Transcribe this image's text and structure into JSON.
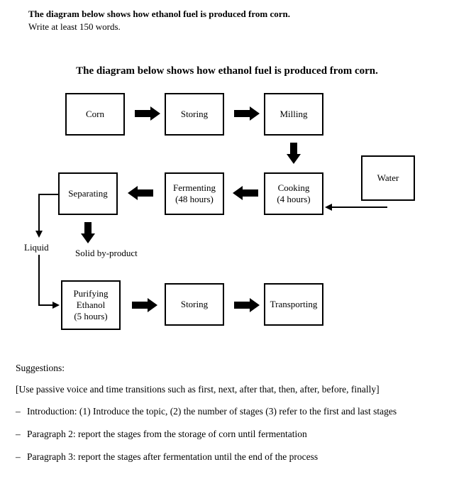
{
  "prompt": {
    "bold": "The diagram below shows how ethanol fuel is produced from corn.",
    "sub": "Write at least 150 words."
  },
  "diagram": {
    "title": "The diagram below shows how ethanol fuel is produced from corn.",
    "nodes": {
      "corn": "Corn",
      "storing1": "Storing",
      "milling": "Milling",
      "water": "Water",
      "cooking": "Cooking\n(4 hours)",
      "fermenting": "Fermenting\n(48 hours)",
      "separating": "Separating",
      "purifying": "Purifying\nEthanol\n(5 hours)",
      "storing2": "Storing",
      "transporting": "Transporting"
    },
    "labels": {
      "liquid": "Liquid",
      "solid": "Solid by-product"
    }
  },
  "suggestions": {
    "heading": "Suggestions:",
    "intro": "[Use passive voice and time transitions such as first, next, after that, then, after, before, finally]",
    "bullets": [
      "Introduction: (1) Introduce the topic, (2) the number of stages (3) refer to the first and last stages",
      "Paragraph 2: report the stages from the storage of corn until fermentation",
      "Paragraph 3: report the stages after fermentation until the end of the process"
    ]
  },
  "chart_data": {
    "type": "diagram",
    "title": "The diagram below shows how ethanol fuel is produced from corn.",
    "nodes": [
      {
        "id": "corn",
        "label": "Corn"
      },
      {
        "id": "storing1",
        "label": "Storing"
      },
      {
        "id": "milling",
        "label": "Milling"
      },
      {
        "id": "water",
        "label": "Water"
      },
      {
        "id": "cooking",
        "label": "Cooking (4 hours)"
      },
      {
        "id": "fermenting",
        "label": "Fermenting (48 hours)"
      },
      {
        "id": "separating",
        "label": "Separating"
      },
      {
        "id": "liquid",
        "label": "Liquid",
        "note": "output of Separating"
      },
      {
        "id": "solid",
        "label": "Solid by-product",
        "note": "output of Separating"
      },
      {
        "id": "purifying",
        "label": "Purifying Ethanol (5 hours)"
      },
      {
        "id": "storing2",
        "label": "Storing"
      },
      {
        "id": "transporting",
        "label": "Transporting"
      }
    ],
    "edges": [
      {
        "from": "corn",
        "to": "storing1"
      },
      {
        "from": "storing1",
        "to": "milling"
      },
      {
        "from": "milling",
        "to": "cooking"
      },
      {
        "from": "water",
        "to": "cooking"
      },
      {
        "from": "cooking",
        "to": "fermenting"
      },
      {
        "from": "fermenting",
        "to": "separating"
      },
      {
        "from": "separating",
        "to": "liquid"
      },
      {
        "from": "separating",
        "to": "solid"
      },
      {
        "from": "liquid",
        "to": "purifying"
      },
      {
        "from": "purifying",
        "to": "storing2"
      },
      {
        "from": "storing2",
        "to": "transporting"
      }
    ]
  }
}
